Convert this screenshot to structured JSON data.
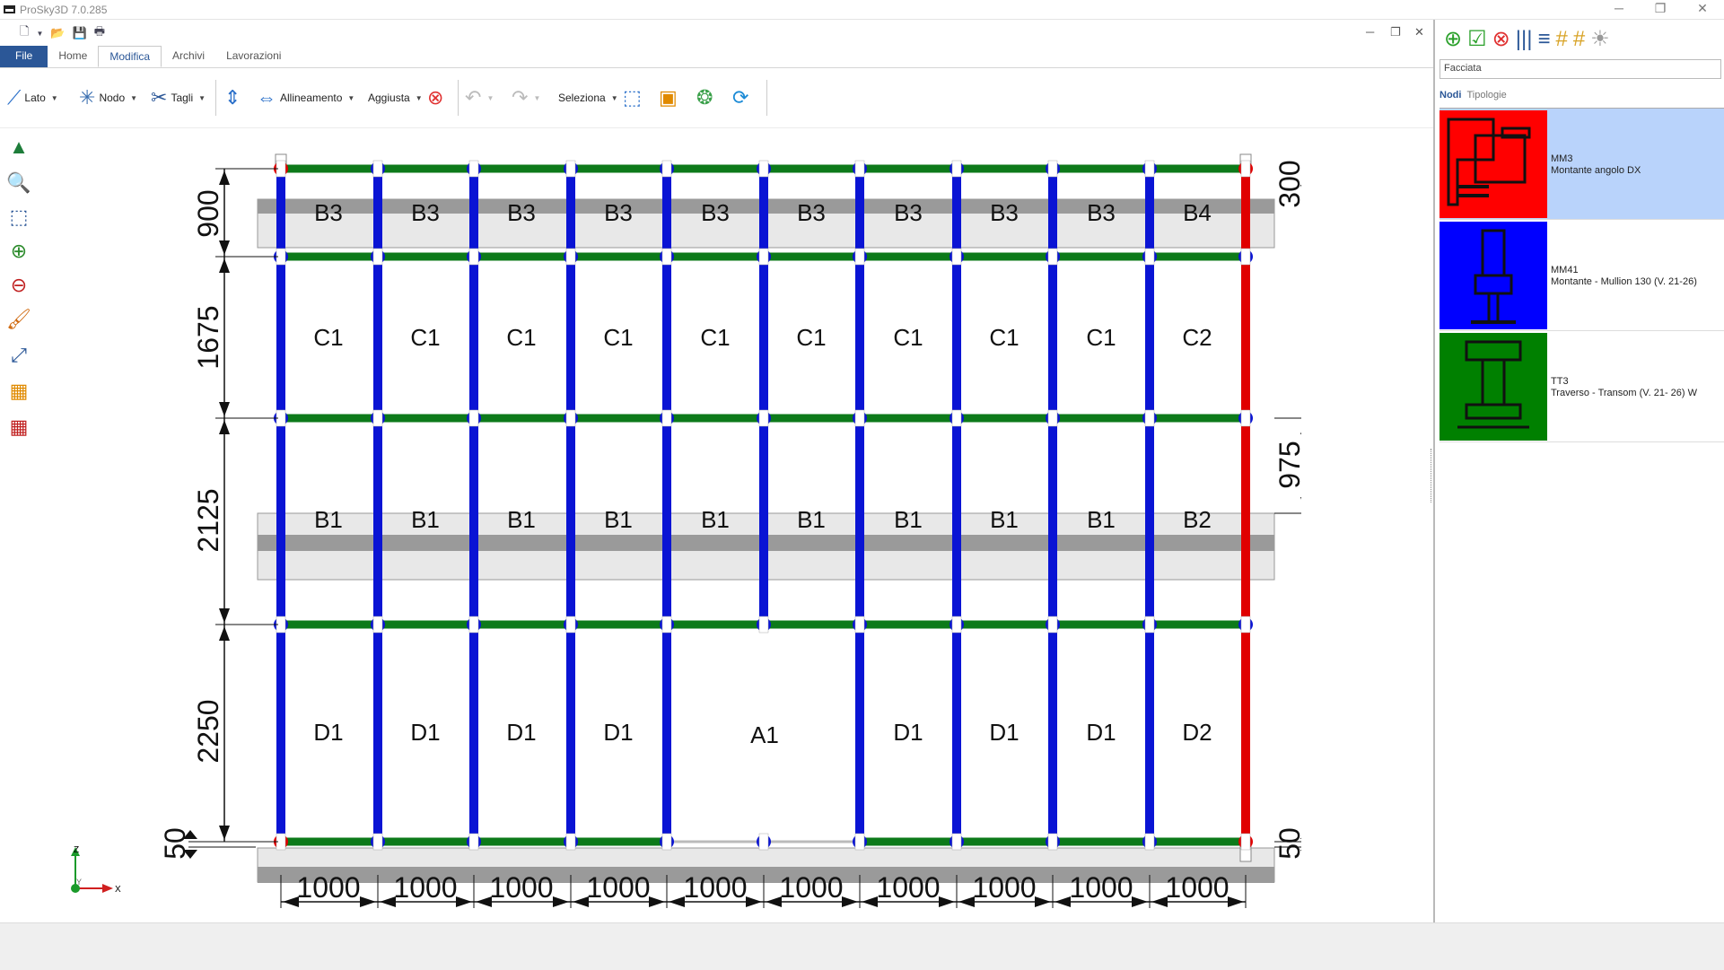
{
  "app": {
    "title": "ProSky3D 7.0.285"
  },
  "menu": {
    "tabs": [
      {
        "label": "File"
      },
      {
        "label": "Home"
      },
      {
        "label": "Modifica"
      },
      {
        "label": "Archivi"
      },
      {
        "label": "Lavorazioni"
      }
    ],
    "active_tab": "Modifica"
  },
  "ribbon": {
    "lato": "Lato",
    "nodo": "Nodo",
    "tagli": "Tagli",
    "allineamento": "Allineamento",
    "aggiusta": "Aggiusta",
    "seleziona": "Seleziona"
  },
  "grid": {
    "column_widths": [
      "1000",
      "1000",
      "1000",
      "1000",
      "1000",
      "1000",
      "1000",
      "1000",
      "1000",
      "1000"
    ],
    "row_heights_left": [
      "900",
      "1675",
      "2125",
      "2250",
      "50"
    ],
    "right_dims": [
      "300",
      "975",
      "50"
    ],
    "row_b3": [
      "B3",
      "B3",
      "B3",
      "B3",
      "B3",
      "B3",
      "B3",
      "B3",
      "B3",
      "B4"
    ],
    "row_c": [
      "C1",
      "C1",
      "C1",
      "C1",
      "C1",
      "C1",
      "C1",
      "C1",
      "C1",
      "C2"
    ],
    "row_b1": [
      "B1",
      "B1",
      "B1",
      "B1",
      "B1",
      "B1",
      "B1",
      "B1",
      "B1",
      "B2"
    ],
    "row_d": [
      "D1",
      "D1",
      "D1",
      "D1",
      "A1",
      "D1",
      "D1",
      "D1",
      "D2"
    ]
  },
  "axis": {
    "z": "Z",
    "x": "X",
    "y": "Y"
  },
  "panel": {
    "search_value": "Facciata",
    "tab_nodi": "Nodi",
    "tab_tipologie": "Tipologie",
    "items": [
      {
        "code": "MM3",
        "desc": "Montante angolo DX",
        "color": "#ff0000"
      },
      {
        "code": "MM41",
        "desc": "Montante - Mullion 130 (V. 21-26)",
        "color": "#0000ff"
      },
      {
        "code": "TT3",
        "desc": "Traverso - Transom (V. 21- 26) W",
        "color": "#008000"
      }
    ]
  },
  "colors": {
    "mullion": "#0a14d4",
    "transom": "#0d7a1a",
    "corner": "#e00000",
    "band": "#9a9a9a",
    "band_light": "#e8e8e8"
  }
}
